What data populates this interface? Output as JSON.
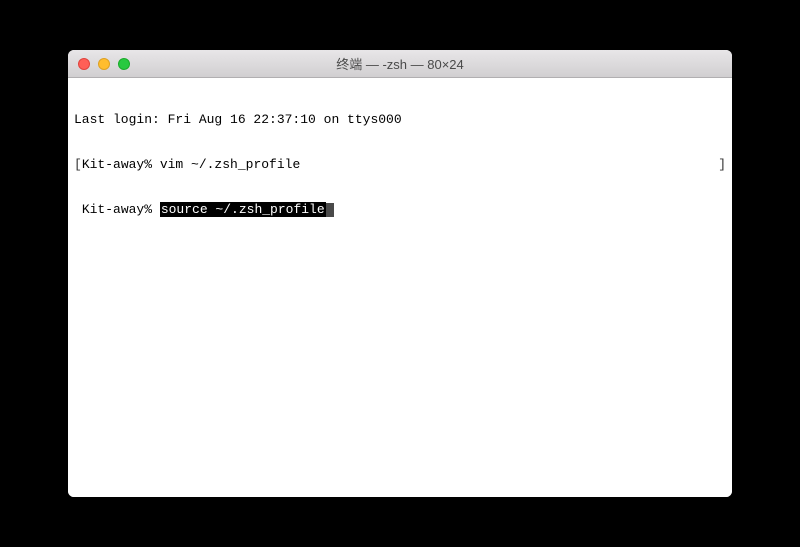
{
  "window": {
    "title": "终端 — -zsh — 80×24"
  },
  "terminal": {
    "line1": "Last login: Fri Aug 16 22:37:10 on ttys000",
    "prompt1_open": "[",
    "prompt1": "Kit-away% ",
    "cmd1": "vim ~/.zsh_profile",
    "prompt1_close": "]",
    "prompt2_open": " ",
    "prompt2": "Kit-away% ",
    "cmd2_highlight": "source ~/.zsh_profile"
  }
}
